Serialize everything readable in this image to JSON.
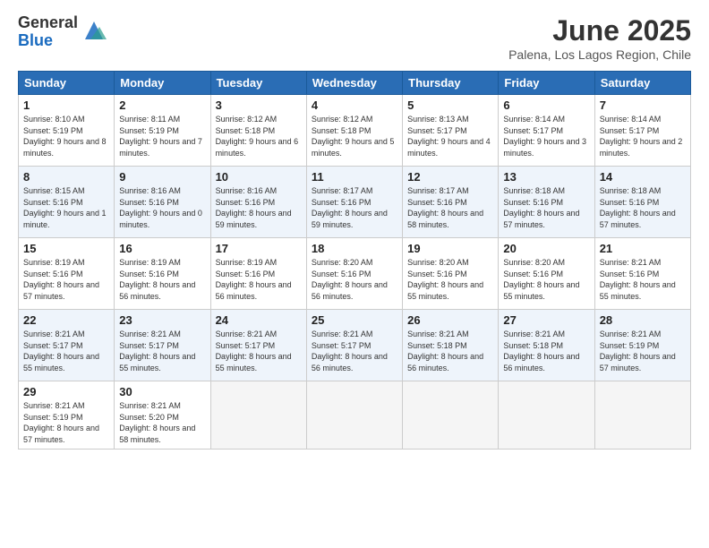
{
  "header": {
    "logo_general": "General",
    "logo_blue": "Blue",
    "month_title": "June 2025",
    "location": "Palena, Los Lagos Region, Chile"
  },
  "days_of_week": [
    "Sunday",
    "Monday",
    "Tuesday",
    "Wednesday",
    "Thursday",
    "Friday",
    "Saturday"
  ],
  "weeks": [
    [
      {
        "day": "1",
        "sunrise": "8:10 AM",
        "sunset": "5:19 PM",
        "daylight": "9 hours and 8 minutes."
      },
      {
        "day": "2",
        "sunrise": "8:11 AM",
        "sunset": "5:19 PM",
        "daylight": "9 hours and 7 minutes."
      },
      {
        "day": "3",
        "sunrise": "8:12 AM",
        "sunset": "5:18 PM",
        "daylight": "9 hours and 6 minutes."
      },
      {
        "day": "4",
        "sunrise": "8:12 AM",
        "sunset": "5:18 PM",
        "daylight": "9 hours and 5 minutes."
      },
      {
        "day": "5",
        "sunrise": "8:13 AM",
        "sunset": "5:17 PM",
        "daylight": "9 hours and 4 minutes."
      },
      {
        "day": "6",
        "sunrise": "8:14 AM",
        "sunset": "5:17 PM",
        "daylight": "9 hours and 3 minutes."
      },
      {
        "day": "7",
        "sunrise": "8:14 AM",
        "sunset": "5:17 PM",
        "daylight": "9 hours and 2 minutes."
      }
    ],
    [
      {
        "day": "8",
        "sunrise": "8:15 AM",
        "sunset": "5:16 PM",
        "daylight": "9 hours and 1 minute."
      },
      {
        "day": "9",
        "sunrise": "8:16 AM",
        "sunset": "5:16 PM",
        "daylight": "9 hours and 0 minutes."
      },
      {
        "day": "10",
        "sunrise": "8:16 AM",
        "sunset": "5:16 PM",
        "daylight": "8 hours and 59 minutes."
      },
      {
        "day": "11",
        "sunrise": "8:17 AM",
        "sunset": "5:16 PM",
        "daylight": "8 hours and 59 minutes."
      },
      {
        "day": "12",
        "sunrise": "8:17 AM",
        "sunset": "5:16 PM",
        "daylight": "8 hours and 58 minutes."
      },
      {
        "day": "13",
        "sunrise": "8:18 AM",
        "sunset": "5:16 PM",
        "daylight": "8 hours and 57 minutes."
      },
      {
        "day": "14",
        "sunrise": "8:18 AM",
        "sunset": "5:16 PM",
        "daylight": "8 hours and 57 minutes."
      }
    ],
    [
      {
        "day": "15",
        "sunrise": "8:19 AM",
        "sunset": "5:16 PM",
        "daylight": "8 hours and 57 minutes."
      },
      {
        "day": "16",
        "sunrise": "8:19 AM",
        "sunset": "5:16 PM",
        "daylight": "8 hours and 56 minutes."
      },
      {
        "day": "17",
        "sunrise": "8:19 AM",
        "sunset": "5:16 PM",
        "daylight": "8 hours and 56 minutes."
      },
      {
        "day": "18",
        "sunrise": "8:20 AM",
        "sunset": "5:16 PM",
        "daylight": "8 hours and 56 minutes."
      },
      {
        "day": "19",
        "sunrise": "8:20 AM",
        "sunset": "5:16 PM",
        "daylight": "8 hours and 55 minutes."
      },
      {
        "day": "20",
        "sunrise": "8:20 AM",
        "sunset": "5:16 PM",
        "daylight": "8 hours and 55 minutes."
      },
      {
        "day": "21",
        "sunrise": "8:21 AM",
        "sunset": "5:16 PM",
        "daylight": "8 hours and 55 minutes."
      }
    ],
    [
      {
        "day": "22",
        "sunrise": "8:21 AM",
        "sunset": "5:17 PM",
        "daylight": "8 hours and 55 minutes."
      },
      {
        "day": "23",
        "sunrise": "8:21 AM",
        "sunset": "5:17 PM",
        "daylight": "8 hours and 55 minutes."
      },
      {
        "day": "24",
        "sunrise": "8:21 AM",
        "sunset": "5:17 PM",
        "daylight": "8 hours and 55 minutes."
      },
      {
        "day": "25",
        "sunrise": "8:21 AM",
        "sunset": "5:17 PM",
        "daylight": "8 hours and 56 minutes."
      },
      {
        "day": "26",
        "sunrise": "8:21 AM",
        "sunset": "5:18 PM",
        "daylight": "8 hours and 56 minutes."
      },
      {
        "day": "27",
        "sunrise": "8:21 AM",
        "sunset": "5:18 PM",
        "daylight": "8 hours and 56 minutes."
      },
      {
        "day": "28",
        "sunrise": "8:21 AM",
        "sunset": "5:19 PM",
        "daylight": "8 hours and 57 minutes."
      }
    ],
    [
      {
        "day": "29",
        "sunrise": "8:21 AM",
        "sunset": "5:19 PM",
        "daylight": "8 hours and 57 minutes."
      },
      {
        "day": "30",
        "sunrise": "8:21 AM",
        "sunset": "5:20 PM",
        "daylight": "8 hours and 58 minutes."
      },
      null,
      null,
      null,
      null,
      null
    ]
  ]
}
